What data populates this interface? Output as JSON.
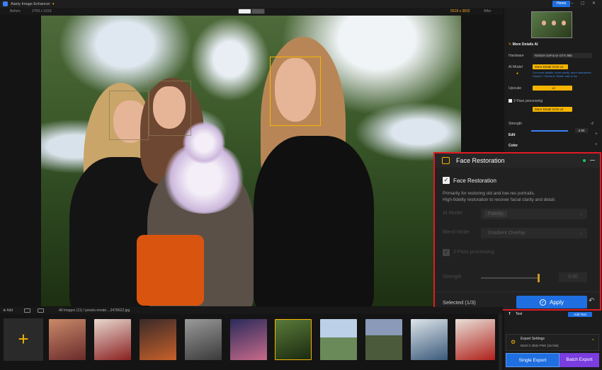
{
  "app": {
    "title": "Aiarty Image Enhancer",
    "home": "Home"
  },
  "viewer": {
    "before": "Before",
    "before_size": "2759 x 1919",
    "after_size": "5518 x 3832",
    "after": "After"
  },
  "right_panel": {
    "section_title": "More Details AI",
    "hardware_label": "Hardware",
    "hardware_value": "NVIDIA GeForce GTX 980",
    "ai_model_label": "AI Model",
    "ai_model_value": "More-Detail GAN  v2",
    "ai_model_help": "For more details, more clarity, more sharpness. Output > Genuine, Better size & fun.",
    "upscale_label": "Upscale",
    "upscale_value": "x2",
    "two_pass_label": "2-Pass processing",
    "two_pass_model": "More-Detail GAN  v2",
    "strength_label": "Strength",
    "strength_value": "0.90",
    "edit": "Edit",
    "color": "Color",
    "text": "Text",
    "add_text": "Add Text",
    "export_settings": "Export Settings",
    "export_info": "5518 X 3832  PNG  [16 bits]",
    "single_export": "Single Export",
    "batch_export": "Batch Export"
  },
  "face_restoration": {
    "title": "Face Restoration",
    "checkbox_label": "Face Restoration",
    "description_1": "Primarily for restoring old and low-res portraits.",
    "description_2": "High-fidelity restoration to recover facial clarity and detail.",
    "ai_model_label": "AI Model",
    "ai_model_value": "Fidelity",
    "blend_mode_label": "Blend Mode",
    "blend_mode_value": "Gradient Overlay",
    "two_pass_label": "2-Pass processing",
    "strength_label": "Strength",
    "strength_value": "0.80",
    "selected": "Selected (1/3)",
    "apply": "Apply",
    "status_color": "#22c55e"
  },
  "bottom_bar": {
    "add": "Add",
    "path": "All Images (11)  /  pexels-mvate....2478622.jpg"
  },
  "colors": {
    "accent": "#1f6fe0",
    "highlight": "#f5b400",
    "popup_border": "#e01b24",
    "batch": "#7a3de0"
  }
}
